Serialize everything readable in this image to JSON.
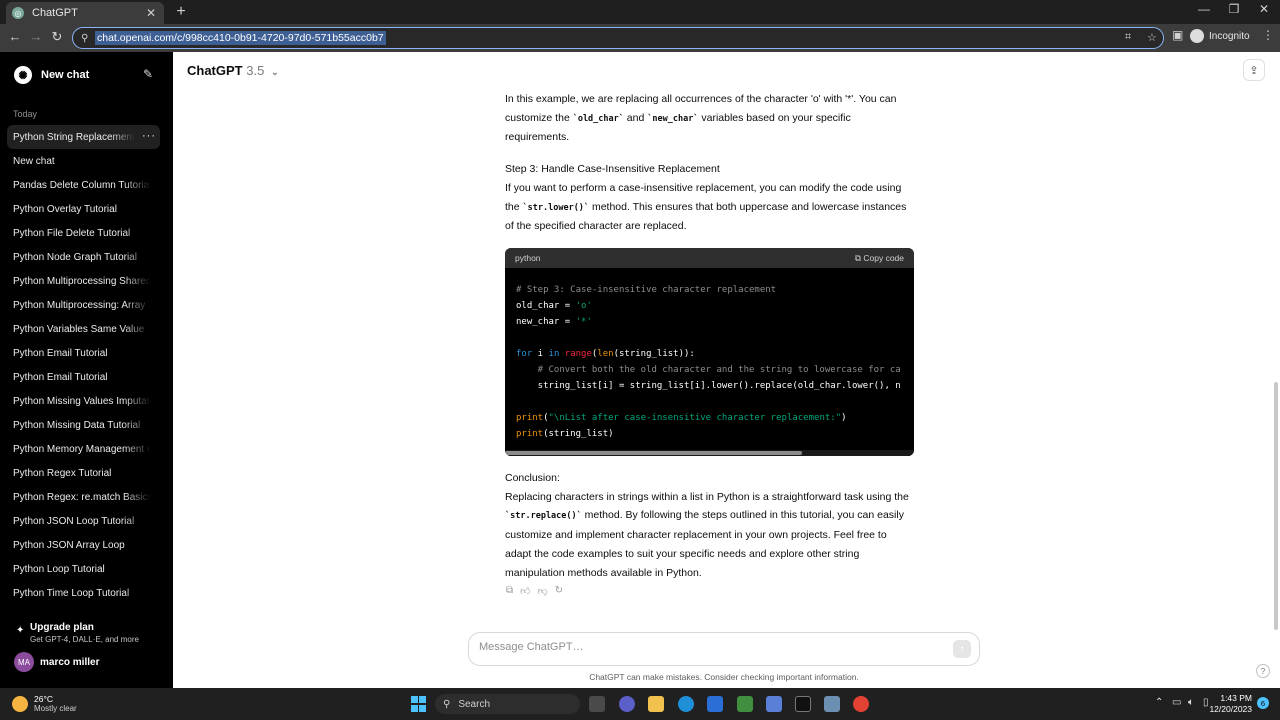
{
  "browser": {
    "tab_title": "ChatGPT",
    "tab_favicon": "chatgpt-favicon",
    "url": "chat.openai.com/c/998cc410-0b91-4720-97d0-571b55acc0b7",
    "profile_label": "Incognito"
  },
  "sidebar": {
    "new_chat_label": "New chat",
    "section_label": "Today",
    "items": [
      {
        "label": "Python String Replacement T"
      },
      {
        "label": "New chat"
      },
      {
        "label": "Pandas Delete Column Tutorial"
      },
      {
        "label": "Python Overlay Tutorial"
      },
      {
        "label": "Python File Delete Tutorial"
      },
      {
        "label": "Python Node Graph Tutorial"
      },
      {
        "label": "Python Multiprocessing Shared A"
      },
      {
        "label": "Python Multiprocessing: Array Tu"
      },
      {
        "label": "Python Variables Same Value"
      },
      {
        "label": "Python Email Tutorial"
      },
      {
        "label": "Python Email Tutorial"
      },
      {
        "label": "Python Missing Values Imputatio"
      },
      {
        "label": "Python Missing Data Tutorial"
      },
      {
        "label": "Python Memory Management Gu"
      },
      {
        "label": "Python Regex Tutorial"
      },
      {
        "label": "Python Regex: re.match Basics"
      },
      {
        "label": "Python JSON Loop Tutorial"
      },
      {
        "label": "Python JSON Array Loop"
      },
      {
        "label": "Python Loop Tutorial"
      },
      {
        "label": "Python Time Loop Tutorial"
      }
    ],
    "upgrade_title": "Upgrade plan",
    "upgrade_subtitle": "Get GPT-4, DALL·E, and more",
    "user_initials": "MA",
    "user_name": "marco miller"
  },
  "header": {
    "model_name": "ChatGPT",
    "model_version": "3.5"
  },
  "message": {
    "p1_a": "In this example, we are replacing all occurrences of the character 'o' with '*'. You can customize the ",
    "p1_code1": "`old_char`",
    "p1_b": " and ",
    "p1_code2": "`new_char`",
    "p1_c": " variables based on your specific requirements.",
    "step3_heading": "Step 3: Handle Case-Insensitive Replacement",
    "p2_a": "If you want to perform a case-insensitive replacement, you can modify the code using the ",
    "p2_code": "`str.lower()`",
    "p2_b": " method. This ensures that both uppercase and lowercase instances of the specified character are replaced.",
    "code_lang": "python",
    "copy_label": "Copy code",
    "code": {
      "l1": "# Step 3: Case-insensitive character replacement",
      "l2_a": "old_char = ",
      "l2_s": "'o'",
      "l3_a": "new_char = ",
      "l3_s": "'*'",
      "l5_for": "for",
      "l5_i": " i ",
      "l5_in": "in",
      "l5_sp": " ",
      "l5_range": "range",
      "l5_p": "(",
      "l5_len": "len",
      "l5_end": "(string_list)):",
      "l6": "    # Convert both the old character and the string to lowercase for ca",
      "l7": "    string_list[i] = string_list[i].lower().replace(old_char.lower(), n",
      "l9_print": "print",
      "l9_p": "(",
      "l9_s": "\"\\nList after case-insensitive character replacement:\"",
      "l9_e": ")",
      "l10_print": "print",
      "l10_e": "(string_list)"
    },
    "conclusion_heading": "Conclusion:",
    "p3_a": "Replacing characters in strings within a list in Python is a straightforward task using the ",
    "p3_code": "`str.replace()`",
    "p3_b": " method. By following the steps outlined in this tutorial, you can easily customize and implement character replacement in your own projects. Feel free to adapt the code examples to suit your specific needs and explore other string manipulation methods available in Python."
  },
  "composer": {
    "placeholder": "Message ChatGPT…",
    "disclaimer": "ChatGPT can make mistakes. Consider checking important information.",
    "help": "?"
  },
  "taskbar": {
    "weather_temp": "26°C",
    "weather_condition": "Mostly clear",
    "search_label": "Search",
    "time": "1:43 PM",
    "date": "12/20/2023",
    "notification_count": "6"
  }
}
